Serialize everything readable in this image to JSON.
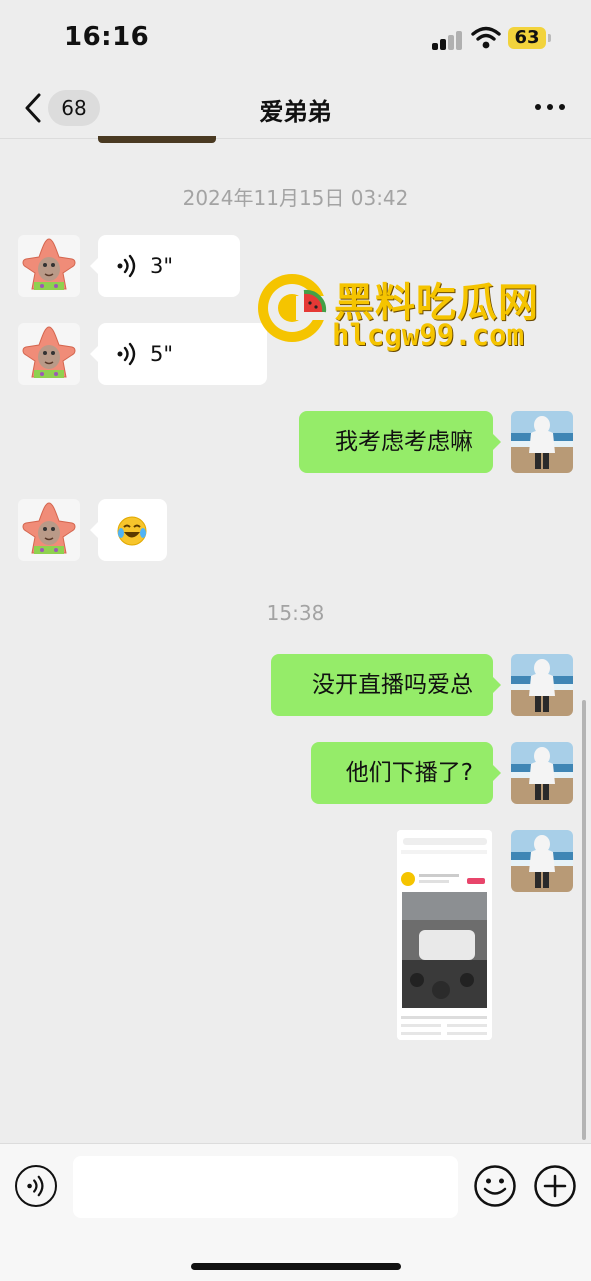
{
  "status_bar": {
    "time": "16:16",
    "battery": "63"
  },
  "header": {
    "unread_count": "68",
    "title": "爱弟弟"
  },
  "messages": {
    "timestamp_1": "2024年11月15日 03:42",
    "voice_1_duration": "3\"",
    "voice_2_duration": "5\"",
    "text_1": "我考虑考虑嘛",
    "emoji_1": "😂",
    "timestamp_2": "15:38",
    "text_2": "没开直播吗爱总",
    "text_3": "他们下播了?"
  },
  "watermark": {
    "name": "黑料吃瓜网",
    "url": "hlcgw99.com"
  },
  "input_bar": {
    "placeholder": ""
  },
  "icons": {
    "back": "chevron-left-icon",
    "more": "more-dots-icon",
    "voice": "voice-wave-icon",
    "emoji": "smiley-icon",
    "plus": "plus-icon"
  },
  "colors": {
    "outgoing_bubble": "#95ec69",
    "incoming_bubble": "#ffffff",
    "background": "#ededed"
  }
}
